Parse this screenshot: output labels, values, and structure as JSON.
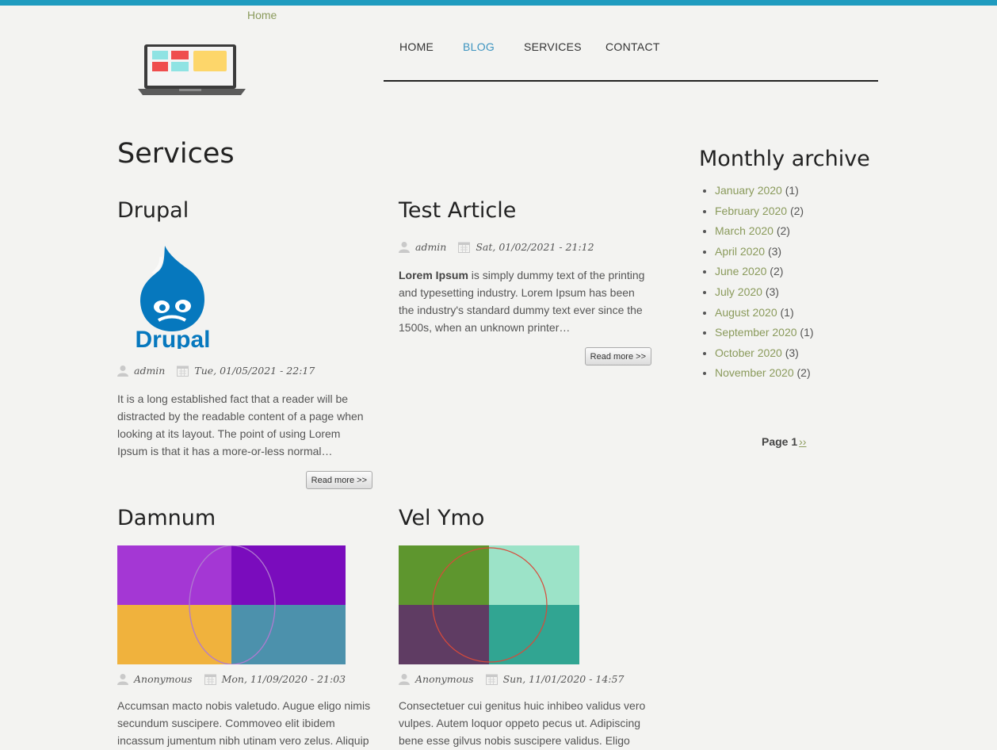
{
  "breadcrumb": {
    "home": "Home"
  },
  "nav": {
    "items": [
      "HOME",
      "BLOG",
      "SERVICES",
      "CONTACT"
    ],
    "active": "BLOG"
  },
  "page": {
    "title": "Services"
  },
  "articles": [
    {
      "title": "Drupal",
      "author": "admin",
      "date": "Tue, 01/05/2021 - 22:17",
      "body": "It is a long established fact that a reader will be distracted by the readable content of a page when looking at its layout. The point of using Lorem Ipsum is that it has a more-or-less normal…",
      "read_more": "Read more >>",
      "logo_text": "Drupal"
    },
    {
      "title": "Test Article",
      "author": "admin",
      "date": "Sat, 01/02/2021 - 21:12",
      "body_bold": "Lorem Ipsum",
      "body": " is simply dummy text of the printing and typesetting industry. Lorem Ipsum has been the industry's standard dummy text ever since the 1500s, when an unknown printer…",
      "read_more": "Read more >>"
    },
    {
      "title": "Damnum",
      "author": "Anonymous",
      "date": "Mon, 11/09/2020 - 21:03",
      "body": "Accumsan macto nobis valetudo. Augue eligo nimis secundum suscipere. Commoveo elit ibidem incassum jumentum nibh utinam vero zelus. Aliquip"
    },
    {
      "title": "Vel Ymo",
      "author": "Anonymous",
      "date": "Sun, 11/01/2020 - 14:57",
      "body": "Consectetuer cui genitus huic inhibeo validus vero vulpes. Autem loquor oppeto pecus ut. Adipiscing bene esse gilvus nobis suscipere validus. Eligo"
    }
  ],
  "sidebar": {
    "title": "Monthly archive",
    "items": [
      {
        "label": "January 2020",
        "count": "(1)"
      },
      {
        "label": "February 2020",
        "count": "(2)"
      },
      {
        "label": "March 2020",
        "count": "(2)"
      },
      {
        "label": "April 2020",
        "count": "(3)"
      },
      {
        "label": "June 2020",
        "count": "(2)"
      },
      {
        "label": "July 2020",
        "count": "(3)"
      },
      {
        "label": "August 2020",
        "count": "(1)"
      },
      {
        "label": "September 2020",
        "count": "(1)"
      },
      {
        "label": "October 2020",
        "count": "(3)"
      },
      {
        "label": "November 2020",
        "count": "(2)"
      }
    ]
  },
  "pager": {
    "current": "Page 1",
    "next": "››"
  },
  "colors": {
    "accent_bar": "#1f9bbf",
    "link": "#8a9a5b",
    "active_nav": "#3d94c0"
  }
}
